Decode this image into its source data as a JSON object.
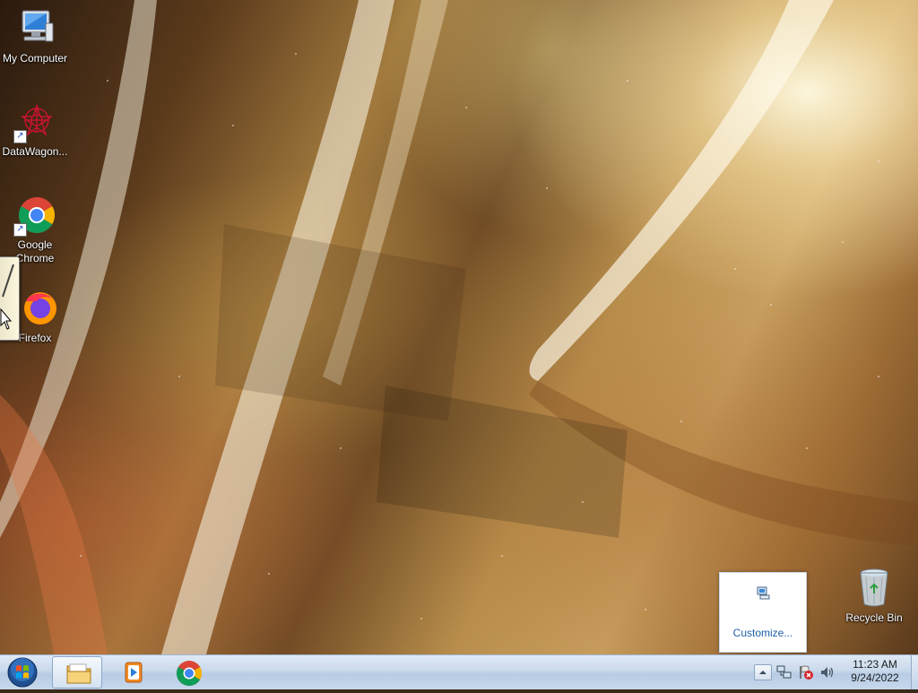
{
  "desktop": {
    "icons": [
      {
        "label": "My Computer",
        "icon": "computer-icon"
      },
      {
        "label": "DataWagon...",
        "icon": "datawagon-icon"
      },
      {
        "label": "Google Chrome",
        "icon": "chrome-icon"
      },
      {
        "label": "Firefox",
        "icon": "firefox-icon"
      },
      {
        "label": "Recycle Bin",
        "icon": "recycle-bin-icon"
      }
    ]
  },
  "tray_popup": {
    "link_label": "Customize...",
    "icon": "network-tray-icon"
  },
  "taskbar": {
    "start_icon": "windows-start-icon",
    "pinned": [
      {
        "name": "windows-explorer",
        "icon": "folder-icon",
        "active": true
      },
      {
        "name": "windows-media-player",
        "icon": "media-player-icon",
        "active": false
      },
      {
        "name": "google-chrome",
        "icon": "chrome-icon",
        "active": false
      }
    ],
    "tray": {
      "icons": [
        "show-hidden-icons-arrow",
        "network-icon",
        "action-center-flag-icon",
        "volume-icon"
      ]
    },
    "clock": {
      "time": "11:23 AM",
      "date": "9/24/2022"
    }
  },
  "colors": {
    "taskbar": "#c9d9ec",
    "link": "#1f5fa8"
  }
}
